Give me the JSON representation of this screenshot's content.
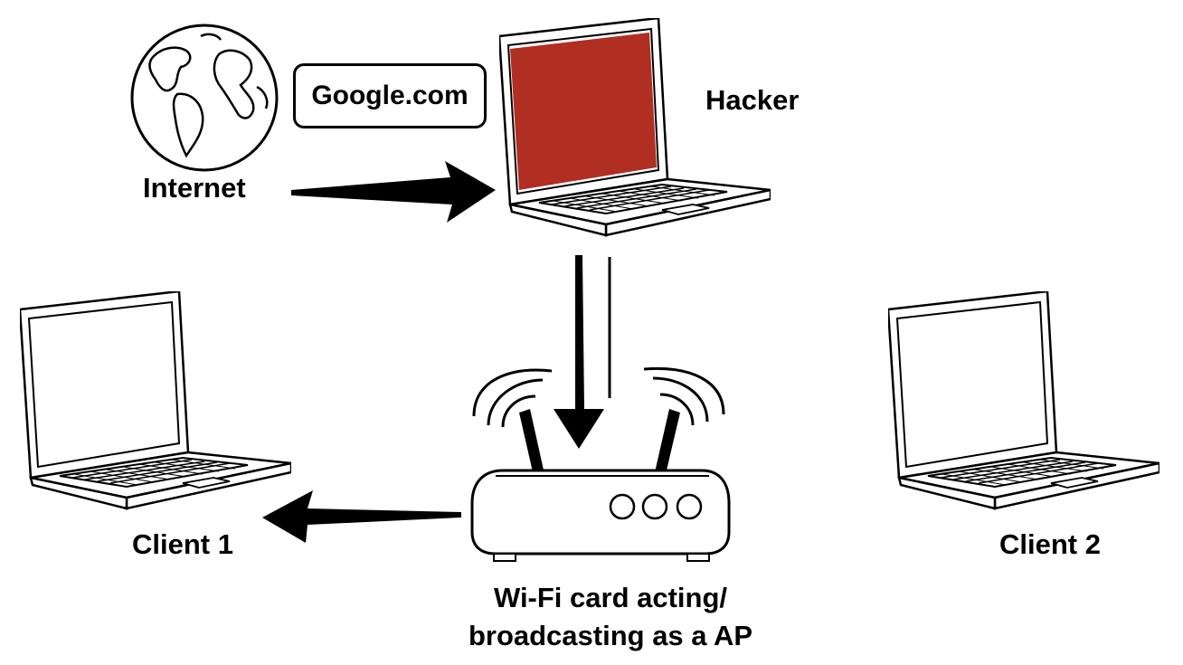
{
  "labels": {
    "internet": "Internet",
    "hacker": "Hacker",
    "client1": "Client 1",
    "client2": "Client 2",
    "ap_line1": "Wi-Fi card acting/",
    "ap_line2": "broadcasting as a AP",
    "google": "Google.com"
  },
  "colors": {
    "hacker_screen": "#b02e22",
    "client_screen": "#ffffff",
    "stroke": "#000000"
  },
  "icons": [
    "globe-icon",
    "laptop-icon",
    "router-icon",
    "arrow-icon"
  ]
}
